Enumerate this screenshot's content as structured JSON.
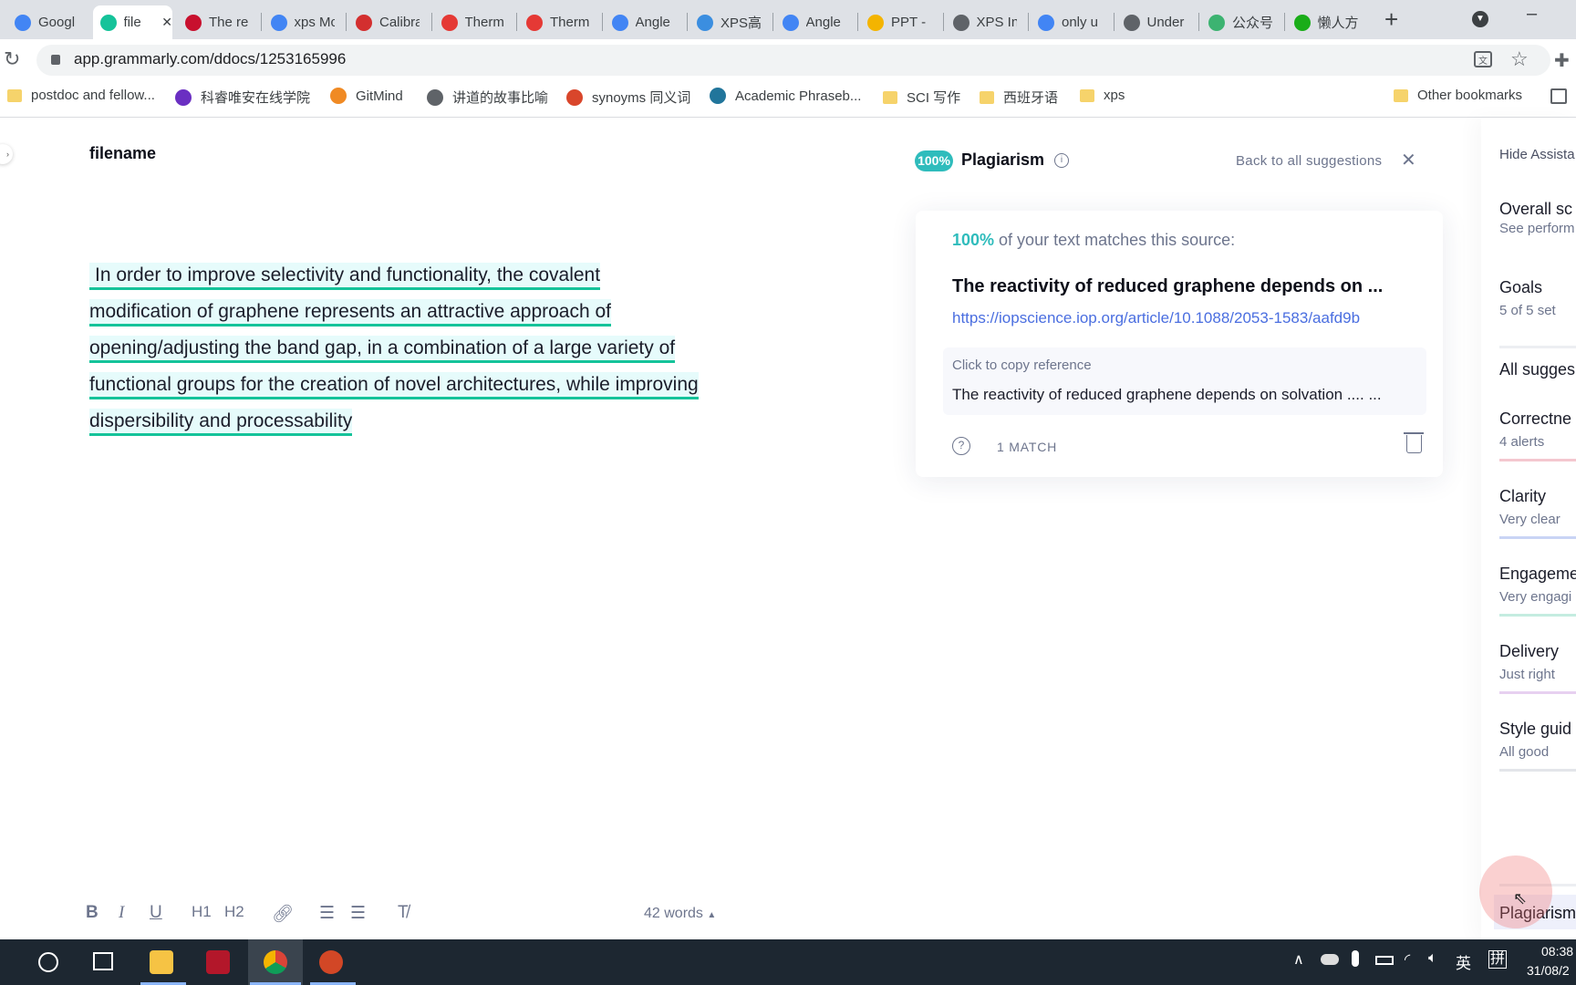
{
  "browser": {
    "tabs": [
      {
        "label": "Googl",
        "icon": "google-translate-icon",
        "color": "#4285f4"
      },
      {
        "label": "file",
        "icon": "grammarly-icon",
        "color": "#15c39a",
        "active": true
      },
      {
        "label": "The re",
        "icon": "iop-icon",
        "color": "#c8102e"
      },
      {
        "label": "xps Mc",
        "icon": "google-icon",
        "color": "#4285f4"
      },
      {
        "label": "Calibra",
        "icon": "calibra-icon",
        "color": "#d32f2f"
      },
      {
        "label": "Therm",
        "icon": "thermo-icon",
        "color": "#e53935"
      },
      {
        "label": "Therm",
        "icon": "thermo-icon",
        "color": "#e53935"
      },
      {
        "label": "Angle",
        "icon": "google-icon",
        "color": "#4285f4"
      },
      {
        "label": "XPS高",
        "icon": "translate-icon",
        "color": "#3b8ee0"
      },
      {
        "label": "Angle",
        "icon": "google-icon",
        "color": "#4285f4"
      },
      {
        "label": "PPT - ",
        "icon": "ppt-site-icon",
        "color": "#f4b400"
      },
      {
        "label": "XPS In",
        "icon": "globe-icon",
        "color": "#5f6368"
      },
      {
        "label": "only u",
        "icon": "google-icon",
        "color": "#4285f4"
      },
      {
        "label": "Under",
        "icon": "globe-icon",
        "color": "#5f6368"
      },
      {
        "label": "公众号",
        "icon": "wechat-official-icon",
        "color": "#3cb371"
      },
      {
        "label": "懒人方",
        "icon": "wechat-icon",
        "color": "#1aad19"
      }
    ],
    "url": "app.grammarly.com/ddocs/1253165996",
    "bookmarks": [
      {
        "label": "postdoc and fellow...",
        "icon": "folder-icon"
      },
      {
        "label": "科睿唯安在线学院",
        "icon": "clarivate-icon"
      },
      {
        "label": "GitMind",
        "icon": "gitmind-icon"
      },
      {
        "label": "讲道的故事比喻",
        "icon": "globe-icon"
      },
      {
        "label": "synoyms 同义词",
        "icon": "thesaurus-icon"
      },
      {
        "label": "Academic Phraseb...",
        "icon": "wordpress-icon"
      },
      {
        "label": "SCI 写作",
        "icon": "folder-icon"
      },
      {
        "label": "西班牙语",
        "icon": "folder-icon"
      },
      {
        "label": "xps",
        "icon": "folder-icon"
      }
    ],
    "other_bookmarks": "Other bookmarks"
  },
  "document": {
    "filename": "filename",
    "lines": [
      "In order to improve selectivity and functionality, the covalent",
      "modification of graphene represents an attractive approach of",
      "opening/adjusting the band gap, in a combination of a large variety of",
      "functional groups for the creation of novel architectures, while improving",
      "dispersibility and processability"
    ],
    "word_count": "42 words"
  },
  "plagiarism": {
    "badge": "100%",
    "title": "Plagiarism",
    "back_label": "Back to all suggestions",
    "card": {
      "percent": "100%",
      "match_text": " of your text matches this source:",
      "source_title": "The reactivity of reduced graphene depends on ...",
      "source_url": "https://iopscience.iop.org/article/10.1088/2053-1583/aafd9b",
      "copy_label": "Click to copy reference",
      "reference": "The reactivity of reduced graphene depends on solvation .... ...",
      "match_count": "1 MATCH"
    },
    "accent": "#2fbcbc"
  },
  "assistant": {
    "hide": "Hide Assista",
    "overall": {
      "title": "Overall sc",
      "sub": "See perform"
    },
    "goals": {
      "title": "Goals",
      "sub": "5 of 5 set"
    },
    "all_suggestions": "All sugges",
    "categories": [
      {
        "title": "Correctne",
        "sub": "4 alerts",
        "color": "#f4c7cf"
      },
      {
        "title": "Clarity",
        "sub": "Very clear",
        "color": "#c9d4f5"
      },
      {
        "title": "Engageme",
        "sub": "Very engagi",
        "color": "#c4ece0"
      },
      {
        "title": "Delivery",
        "sub": "Just right",
        "color": "#e7d0f0"
      },
      {
        "title": "Style guid",
        "sub": "All good",
        "color": "#e3e5ea"
      }
    ],
    "plagiarism": "Plagiarism"
  },
  "taskbar": {
    "time": "08:38",
    "date": "31/08/2",
    "ime1": "英",
    "ime2": "拼"
  }
}
